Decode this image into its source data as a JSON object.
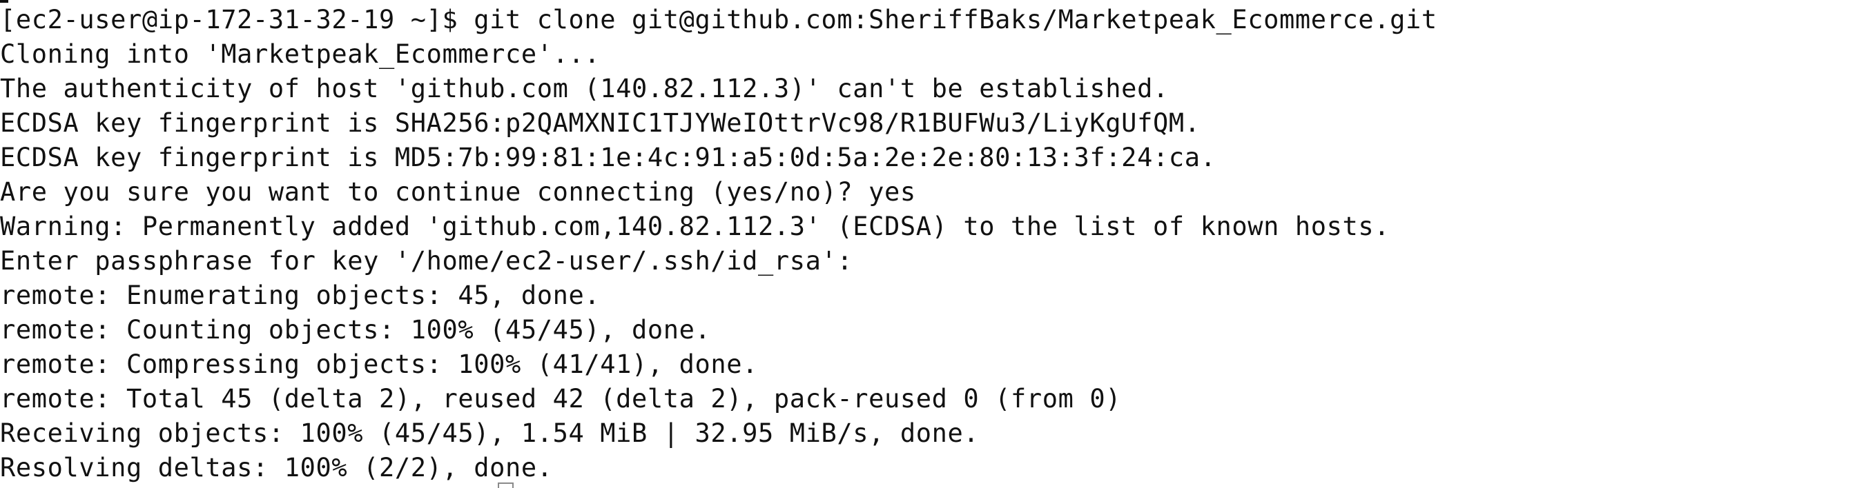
{
  "terminal": {
    "prompt": "[ec2-user@ip-172-31-32-19 ~]$ ",
    "command": "git clone git@github.com:SheriffBaks/Marketpeak_Ecommerce.git",
    "output": [
      "Cloning into 'Marketpeak_Ecommerce'...",
      "The authenticity of host 'github.com (140.82.112.3)' can't be established.",
      "ECDSA key fingerprint is SHA256:p2QAMXNIC1TJYWeIOttrVc98/R1BUFWu3/LiyKgUfQM.",
      "ECDSA key fingerprint is MD5:7b:99:81:1e:4c:91:a5:0d:5a:2e:2e:80:13:3f:24:ca.",
      "Are you sure you want to continue connecting (yes/no)? yes",
      "Warning: Permanently added 'github.com,140.82.112.3' (ECDSA) to the list of known hosts.",
      "Enter passphrase for key '/home/ec2-user/.ssh/id_rsa':",
      "remote: Enumerating objects: 45, done.",
      "remote: Counting objects: 100% (45/45), done.",
      "remote: Compressing objects: 100% (41/41), done.",
      "remote: Total 45 (delta 2), reused 42 (delta 2), pack-reused 0 (from 0)",
      "Receiving objects: 100% (45/45), 1.54 MiB | 32.95 MiB/s, done.",
      "Resolving deltas: 100% (2/2), done."
    ]
  }
}
